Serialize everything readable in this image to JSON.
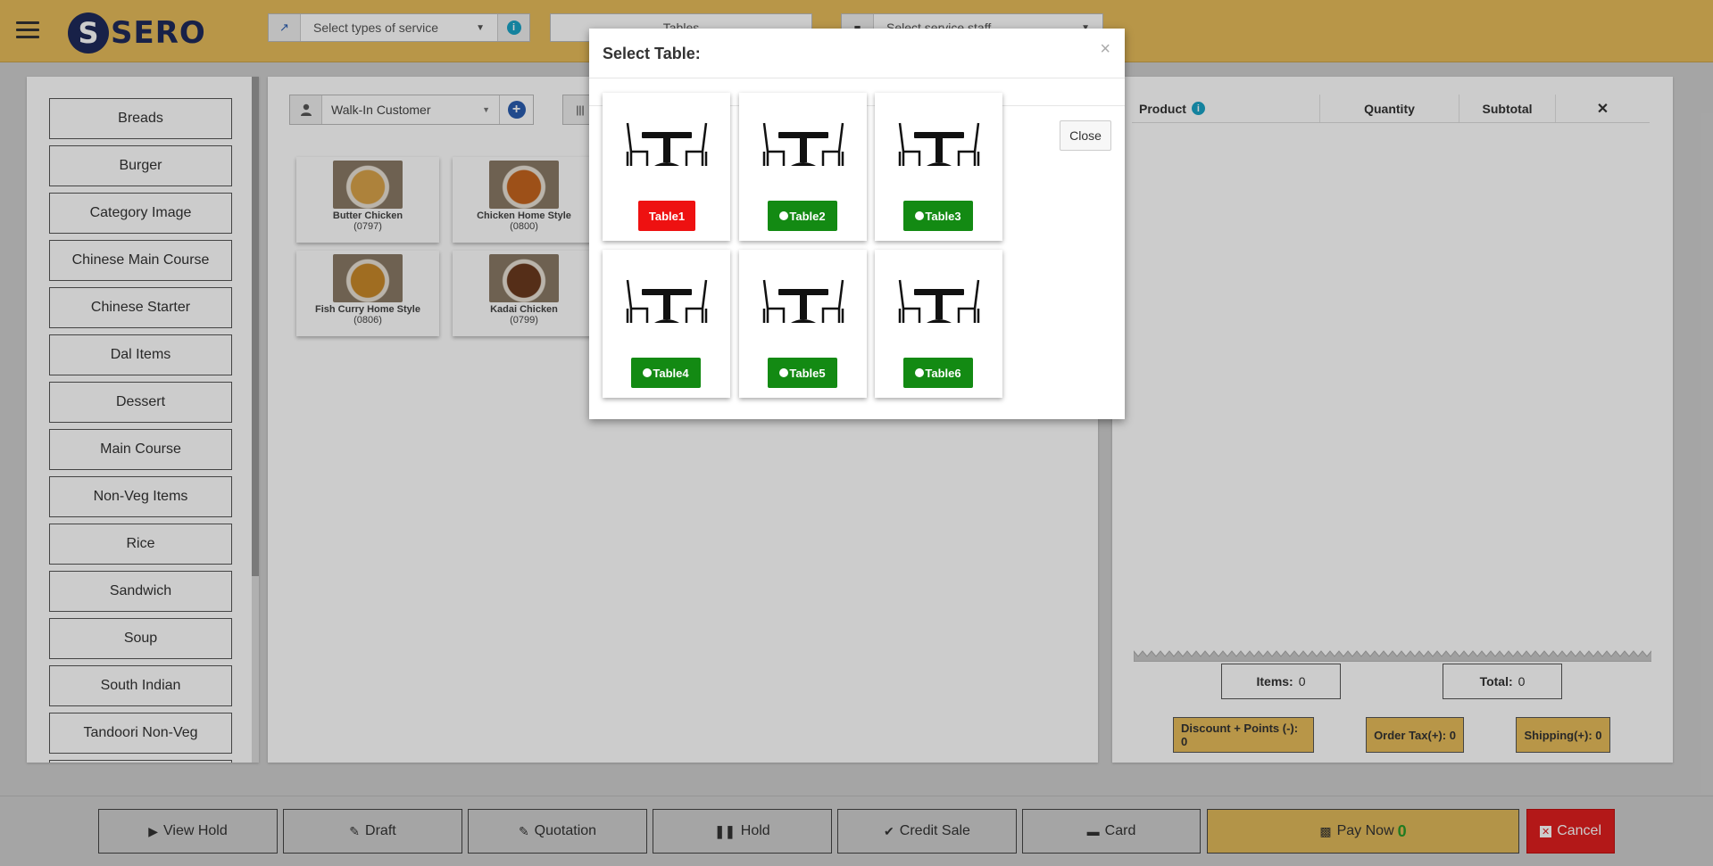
{
  "header": {
    "service_placeholder": "Select types of service",
    "tables_placeholder": "Tables",
    "staff_placeholder": "Select service staff",
    "logo_text": "SERO"
  },
  "categories": [
    "Breads",
    "Burger",
    "Category Image",
    "Chinese Main Course",
    "Chinese Starter",
    "Dal Items",
    "Dessert",
    "Main Course",
    "Non-Veg Items",
    "Rice",
    "Sandwich",
    "Soup",
    "South Indian",
    "Tandoori Non-Veg"
  ],
  "customer": {
    "selected": "Walk-In Customer"
  },
  "products": [
    {
      "name": "Butter Chicken",
      "code": "(0797)",
      "color": "#d9a34a"
    },
    {
      "name": "Chicken Home Style",
      "code": "(0800)",
      "color": "#c5651f"
    },
    {
      "name": "Fish Curry Home Style",
      "code": "(0806)",
      "color": "#c9892a"
    },
    {
      "name": "Kadai Chicken",
      "code": "(0799)",
      "color": "#6b3a1e"
    }
  ],
  "cart": {
    "col_product": "Product",
    "col_quantity": "Quantity",
    "col_subtotal": "Subtotal",
    "items_label": "Items:",
    "items_value": "0",
    "total_label": "Total:",
    "total_value": "0",
    "discount": "Discount + Points (-): 0",
    "order_tax": "Order Tax(+): 0",
    "shipping": "Shipping(+): 0"
  },
  "footer": {
    "view_hold": "View Hold",
    "draft": "Draft",
    "quotation": "Quotation",
    "hold": "Hold",
    "credit_sale": "Credit Sale",
    "card": "Card",
    "pay_now": "Pay Now",
    "pay_now_count": "0",
    "cancel": "Cancel"
  },
  "modal": {
    "title": "Select Table:",
    "close": "Close",
    "tables": [
      {
        "label": "Table1",
        "status": "occupied"
      },
      {
        "label": "Table2",
        "status": "available"
      },
      {
        "label": "Table3",
        "status": "available"
      },
      {
        "label": "Table4",
        "status": "available"
      },
      {
        "label": "Table5",
        "status": "available"
      },
      {
        "label": "Table6",
        "status": "available"
      }
    ]
  },
  "colors": {
    "brand": "#e6bc5a",
    "occupied": "#ee1111",
    "available": "#138a13",
    "cancel": "#e01e1e"
  }
}
